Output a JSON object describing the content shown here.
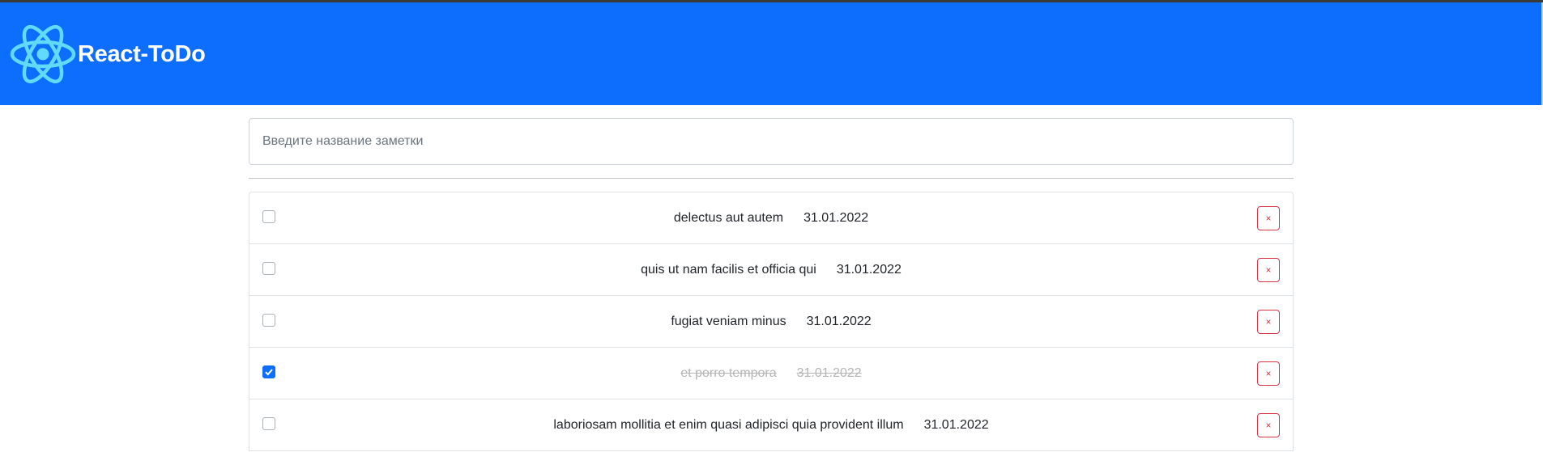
{
  "header": {
    "title": "React-ToDo",
    "logo_icon": "react-atom-icon",
    "background": "#0d6efd",
    "logo_color": "#61dafb"
  },
  "search": {
    "placeholder": "Введите название заметки"
  },
  "todos": [
    {
      "title": "delectus aut autem",
      "date": "31.01.2022",
      "completed": false,
      "delete_label": "×"
    },
    {
      "title": "quis ut nam facilis et officia qui",
      "date": "31.01.2022",
      "completed": false,
      "delete_label": "×"
    },
    {
      "title": "fugiat veniam minus",
      "date": "31.01.2022",
      "completed": false,
      "delete_label": "×"
    },
    {
      "title": "et porro tempora",
      "date": "31.01.2022",
      "completed": true,
      "delete_label": "×"
    },
    {
      "title": "laboriosam mollitia et enim quasi adipisci quia provident illum",
      "date": "31.01.2022",
      "completed": false,
      "delete_label": "×"
    }
  ]
}
